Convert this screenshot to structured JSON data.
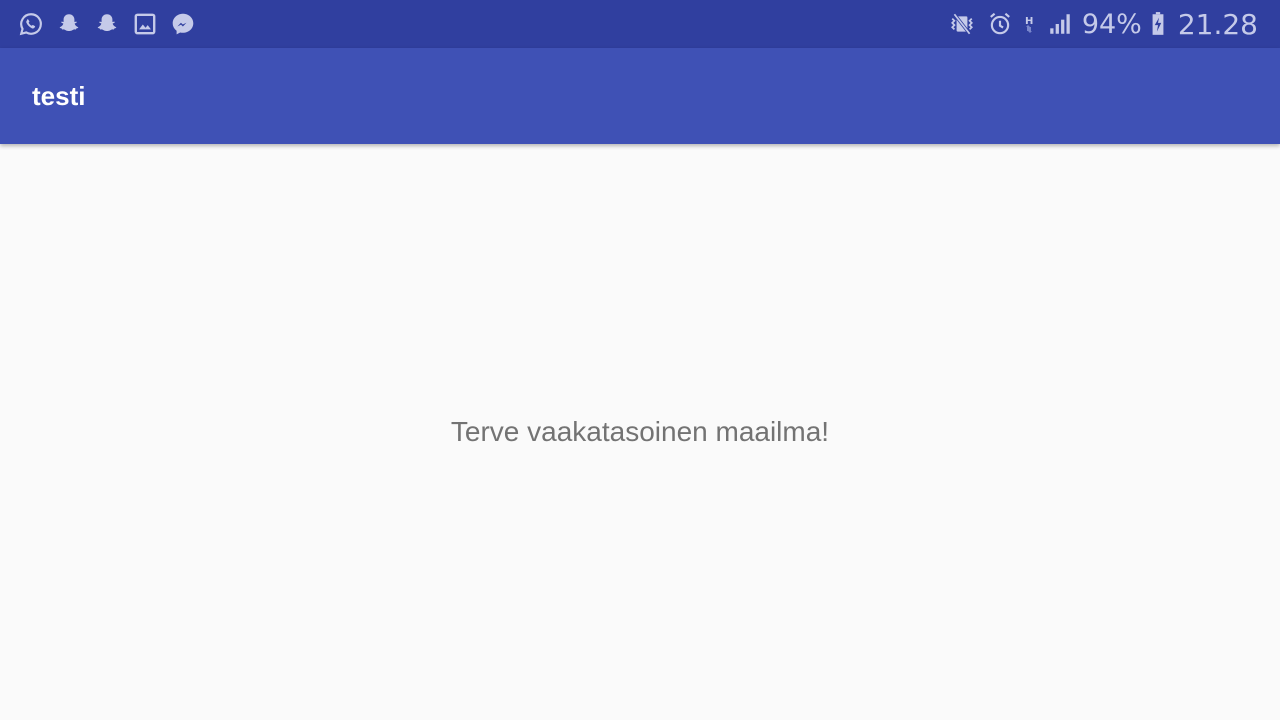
{
  "status_bar": {
    "left_icons": [
      "whatsapp-icon",
      "snapchat-icon",
      "snapchat-icon",
      "gallery-icon",
      "messenger-icon"
    ],
    "right_icons": [
      "vibrate-off-icon",
      "alarm-icon",
      "network-h-icon",
      "signal-icon",
      "battery-charging-icon"
    ],
    "battery_percent": "94%",
    "time": "21.28",
    "color_background": "#303f9f",
    "color_icons": "#c5cae9"
  },
  "app_bar": {
    "title": "testi",
    "color_background": "#3f51b5"
  },
  "main": {
    "text": "Terve vaakatasoinen maailma!"
  }
}
